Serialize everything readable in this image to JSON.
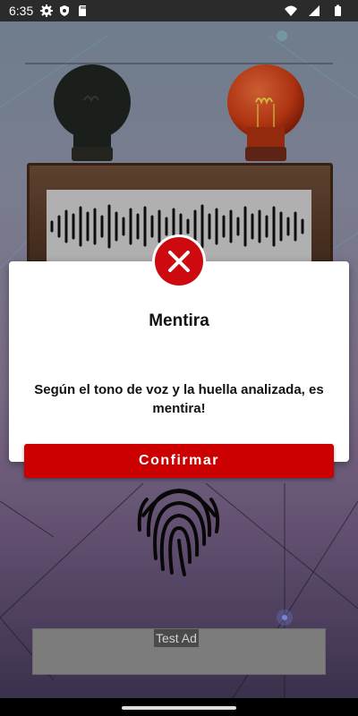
{
  "status_bar": {
    "time": "6:35",
    "left_icons": [
      "settings-icon",
      "shield-icon",
      "sd-card-icon"
    ],
    "right_icons": [
      "wifi-icon",
      "signal-icon",
      "battery-icon"
    ]
  },
  "scene": {
    "left_bulb": "off",
    "right_bulb": "on",
    "left_bulb_color": "#1f241f",
    "right_bulb_color": "#c63b14"
  },
  "dialog": {
    "icon": "error-x-icon",
    "title": "Mentira",
    "message": "Según el tono de voz y la huella analizada, es mentira!",
    "confirm_label": "Confirmar",
    "accent_color": "#cc0000"
  },
  "ad": {
    "label": "Test Ad"
  }
}
